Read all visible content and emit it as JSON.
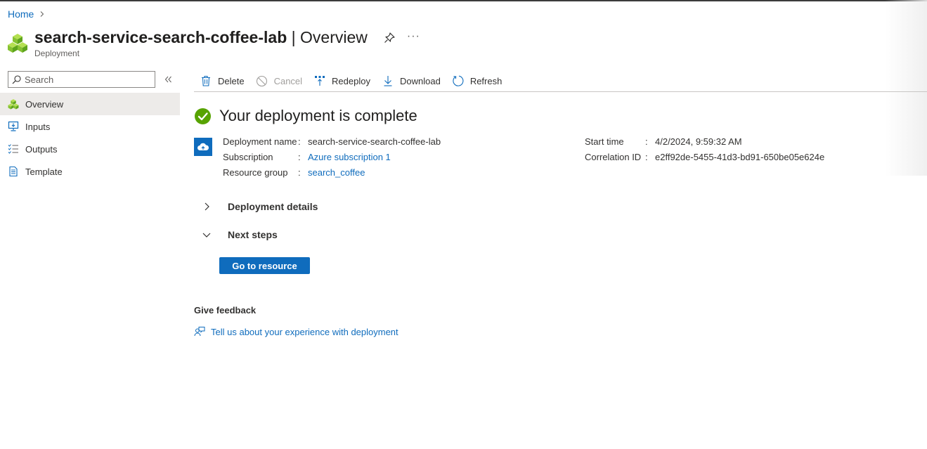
{
  "breadcrumb": {
    "home": "Home"
  },
  "header": {
    "resource_name": "search-service-search-coffee-lab",
    "separator": " | ",
    "page": "Overview",
    "subtitle": "Deployment",
    "more": "···"
  },
  "sidebar": {
    "search_placeholder": "Search",
    "items": [
      {
        "label": "Overview",
        "icon": "deployment-cubes-icon",
        "active": true
      },
      {
        "label": "Inputs",
        "icon": "inputs-icon"
      },
      {
        "label": "Outputs",
        "icon": "outputs-icon"
      },
      {
        "label": "Template",
        "icon": "template-icon"
      }
    ]
  },
  "toolbar": {
    "delete": "Delete",
    "cancel": "Cancel",
    "redeploy": "Redeploy",
    "download": "Download",
    "refresh": "Refresh"
  },
  "status": {
    "message": "Your deployment is complete",
    "color": "#57a300"
  },
  "details": {
    "left": [
      {
        "key": "Deployment name",
        "value": "search-service-search-coffee-lab",
        "link": false
      },
      {
        "key": "Subscription",
        "value": "Azure subscription 1",
        "link": true
      },
      {
        "key": "Resource group",
        "value": "search_coffee",
        "link": true
      }
    ],
    "right": [
      {
        "key": "Start time",
        "value": "4/2/2024, 9:59:32 AM"
      },
      {
        "key": "Correlation ID",
        "value": "e2ff92de-5455-41d3-bd91-650be05e624e"
      }
    ],
    "colon": ":"
  },
  "sections": {
    "deployment_details": "Deployment details",
    "next_steps": "Next steps"
  },
  "go_to_resource": "Go to resource",
  "feedback": {
    "title": "Give feedback",
    "link": "Tell us about your experience with deployment"
  },
  "colors": {
    "accent": "#0f6cbd",
    "success": "#57a300",
    "active_nav": "#edebe9"
  }
}
